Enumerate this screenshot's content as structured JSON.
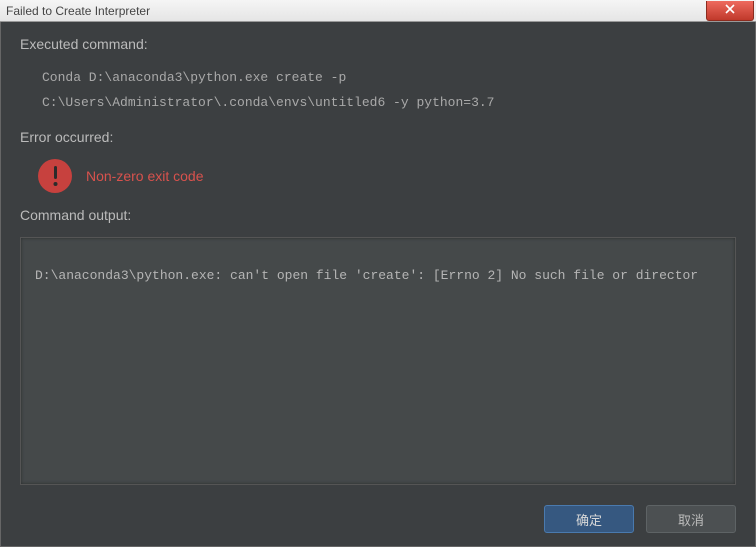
{
  "titlebar": {
    "title": "Failed to Create Interpreter"
  },
  "sections": {
    "executed_label": "Executed command:",
    "error_label": "Error occurred:",
    "output_label": "Command output:"
  },
  "command": {
    "line1": "Conda D:\\anaconda3\\python.exe create -p",
    "line2": "C:\\Users\\Administrator\\.conda\\envs\\untitled6 -y python=3.7"
  },
  "error": {
    "message": "Non-zero exit code"
  },
  "output": {
    "text": "D:\\anaconda3\\python.exe: can't open file 'create': [Errno 2] No such file or director"
  },
  "buttons": {
    "ok": "确定",
    "cancel": "取消"
  }
}
